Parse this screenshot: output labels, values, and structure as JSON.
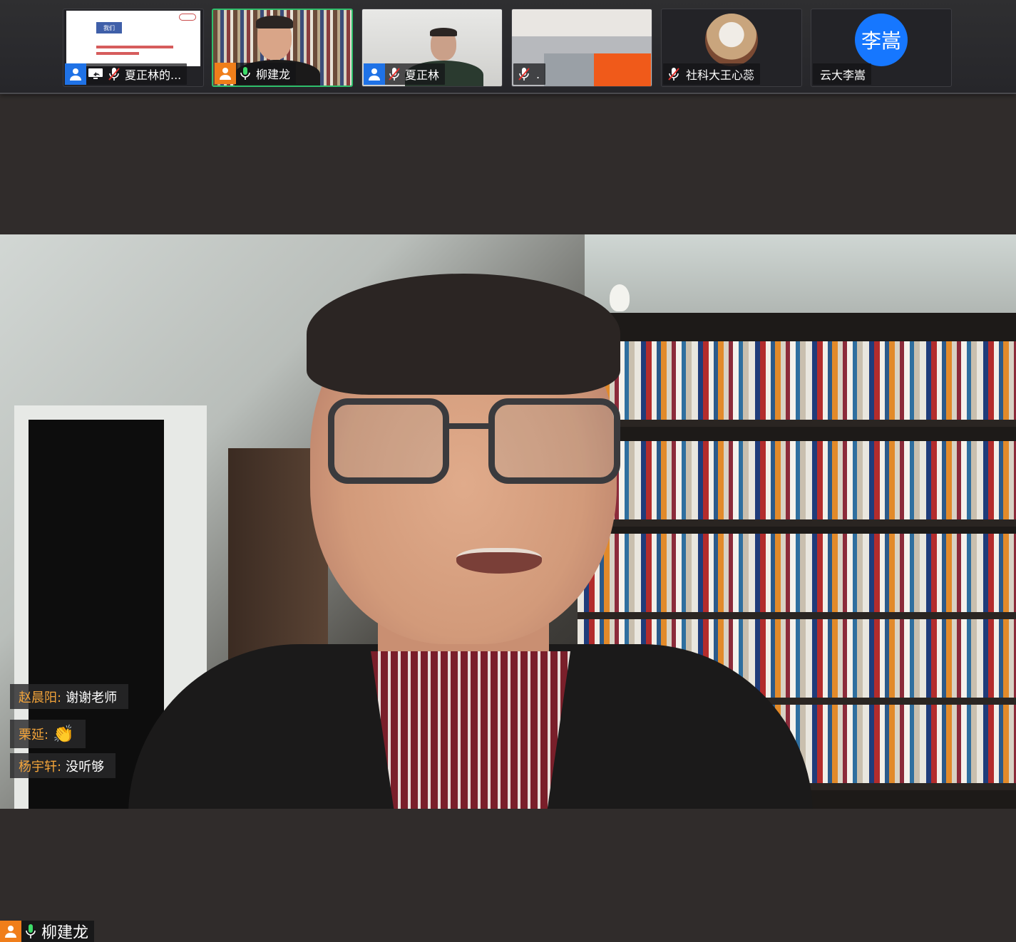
{
  "participants": [
    {
      "name": "夏正林的...",
      "role": "host"
    },
    {
      "name": "柳建龙",
      "role": "co-host"
    },
    {
      "name": "夏正林",
      "role": "host"
    },
    {
      "name": "."
    },
    {
      "name": "社科大王心蕊"
    },
    {
      "name": "云大李嵩",
      "avatar_text": "李嵩"
    }
  ],
  "slide": {
    "header_text": "我们"
  },
  "chat": [
    {
      "sender": "赵晨阳:",
      "text": "谢谢老师"
    },
    {
      "sender": "栗延:",
      "text": "👏"
    },
    {
      "sender": "杨宇轩:",
      "text": "没听够"
    }
  ],
  "active_speaker": {
    "name": "柳建龙"
  },
  "colors": {
    "active_border": "#2fbf6c",
    "host_badge": "#1f72e6",
    "cohost_badge": "#f07e1a",
    "chat_sender": "#f3a43a",
    "avatar_blue": "#1677ff"
  }
}
